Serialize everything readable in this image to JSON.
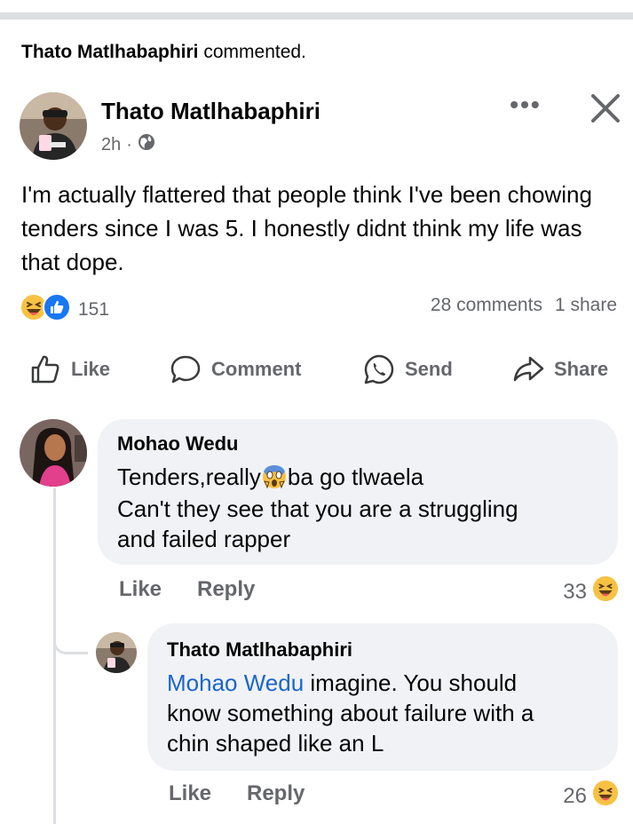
{
  "header": {
    "author": "Thato Matlhabaphiri",
    "action": "commented."
  },
  "post": {
    "author": "Thato Matlhabaphiri",
    "time": "2h",
    "dot": "·",
    "more": "•••",
    "text": "I'm actually flattered that people think I've been chowing tenders since I was 5. I honestly didnt think my life was that dope.",
    "reaction_count": "151",
    "comments": "28 comments",
    "shares": "1 share"
  },
  "actions": {
    "like": "Like",
    "comment": "Comment",
    "send": "Send",
    "share": "Share"
  },
  "comments": [
    {
      "author": "Mohao Wedu",
      "line1_a": "Tenders,really",
      "line1_b": "ba go tlwaela",
      "line2": "Can't they see that you are a struggling",
      "line3": "and failed rapper",
      "like": "Like",
      "reply": "Reply",
      "count": "33"
    },
    {
      "author": "Thato Matlhabaphiri",
      "mention": "Mohao Wedu",
      "line1_rest": " imagine. You should",
      "line2": "know something about failure with a",
      "line3": "chin shaped like an L",
      "like": "Like",
      "reply": "Reply",
      "count": "26"
    }
  ],
  "colors": {
    "link": "#1b66c9",
    "secondary": "#65676b",
    "bubble": "#f0f2f5",
    "like_blue": "#1877f2",
    "haha_yellow": "#f7c244"
  }
}
